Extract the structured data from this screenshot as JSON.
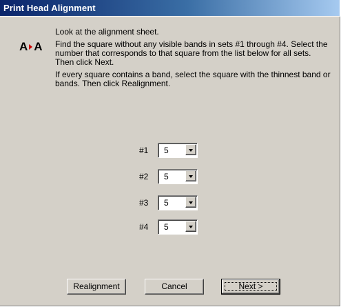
{
  "window": {
    "title": "Print Head Alignment"
  },
  "icon": {
    "name": "alignment-icon",
    "left_letter": "A",
    "right_letter": "A"
  },
  "instructions": {
    "line1": "Look at the alignment sheet.",
    "line2": "Find the square without any visible bands in sets #1 through #4. Select the number that corresponds to that square from the list below for all sets. Then click Next.",
    "line3": "If every square contains a band, select the square with the thinnest band or bands. Then click Realignment."
  },
  "sets": [
    {
      "label": "#1",
      "value": "5"
    },
    {
      "label": "#2",
      "value": "5"
    },
    {
      "label": "#3",
      "value": "5"
    },
    {
      "label": "#4",
      "value": "5"
    }
  ],
  "buttons": {
    "realignment": "Realignment",
    "cancel": "Cancel",
    "next": "Next >"
  },
  "colors": {
    "titlebar_start": "#0a246a",
    "titlebar_end": "#a6caf0",
    "panel": "#d4d0c8",
    "icon_arrow": "#cc0000"
  }
}
